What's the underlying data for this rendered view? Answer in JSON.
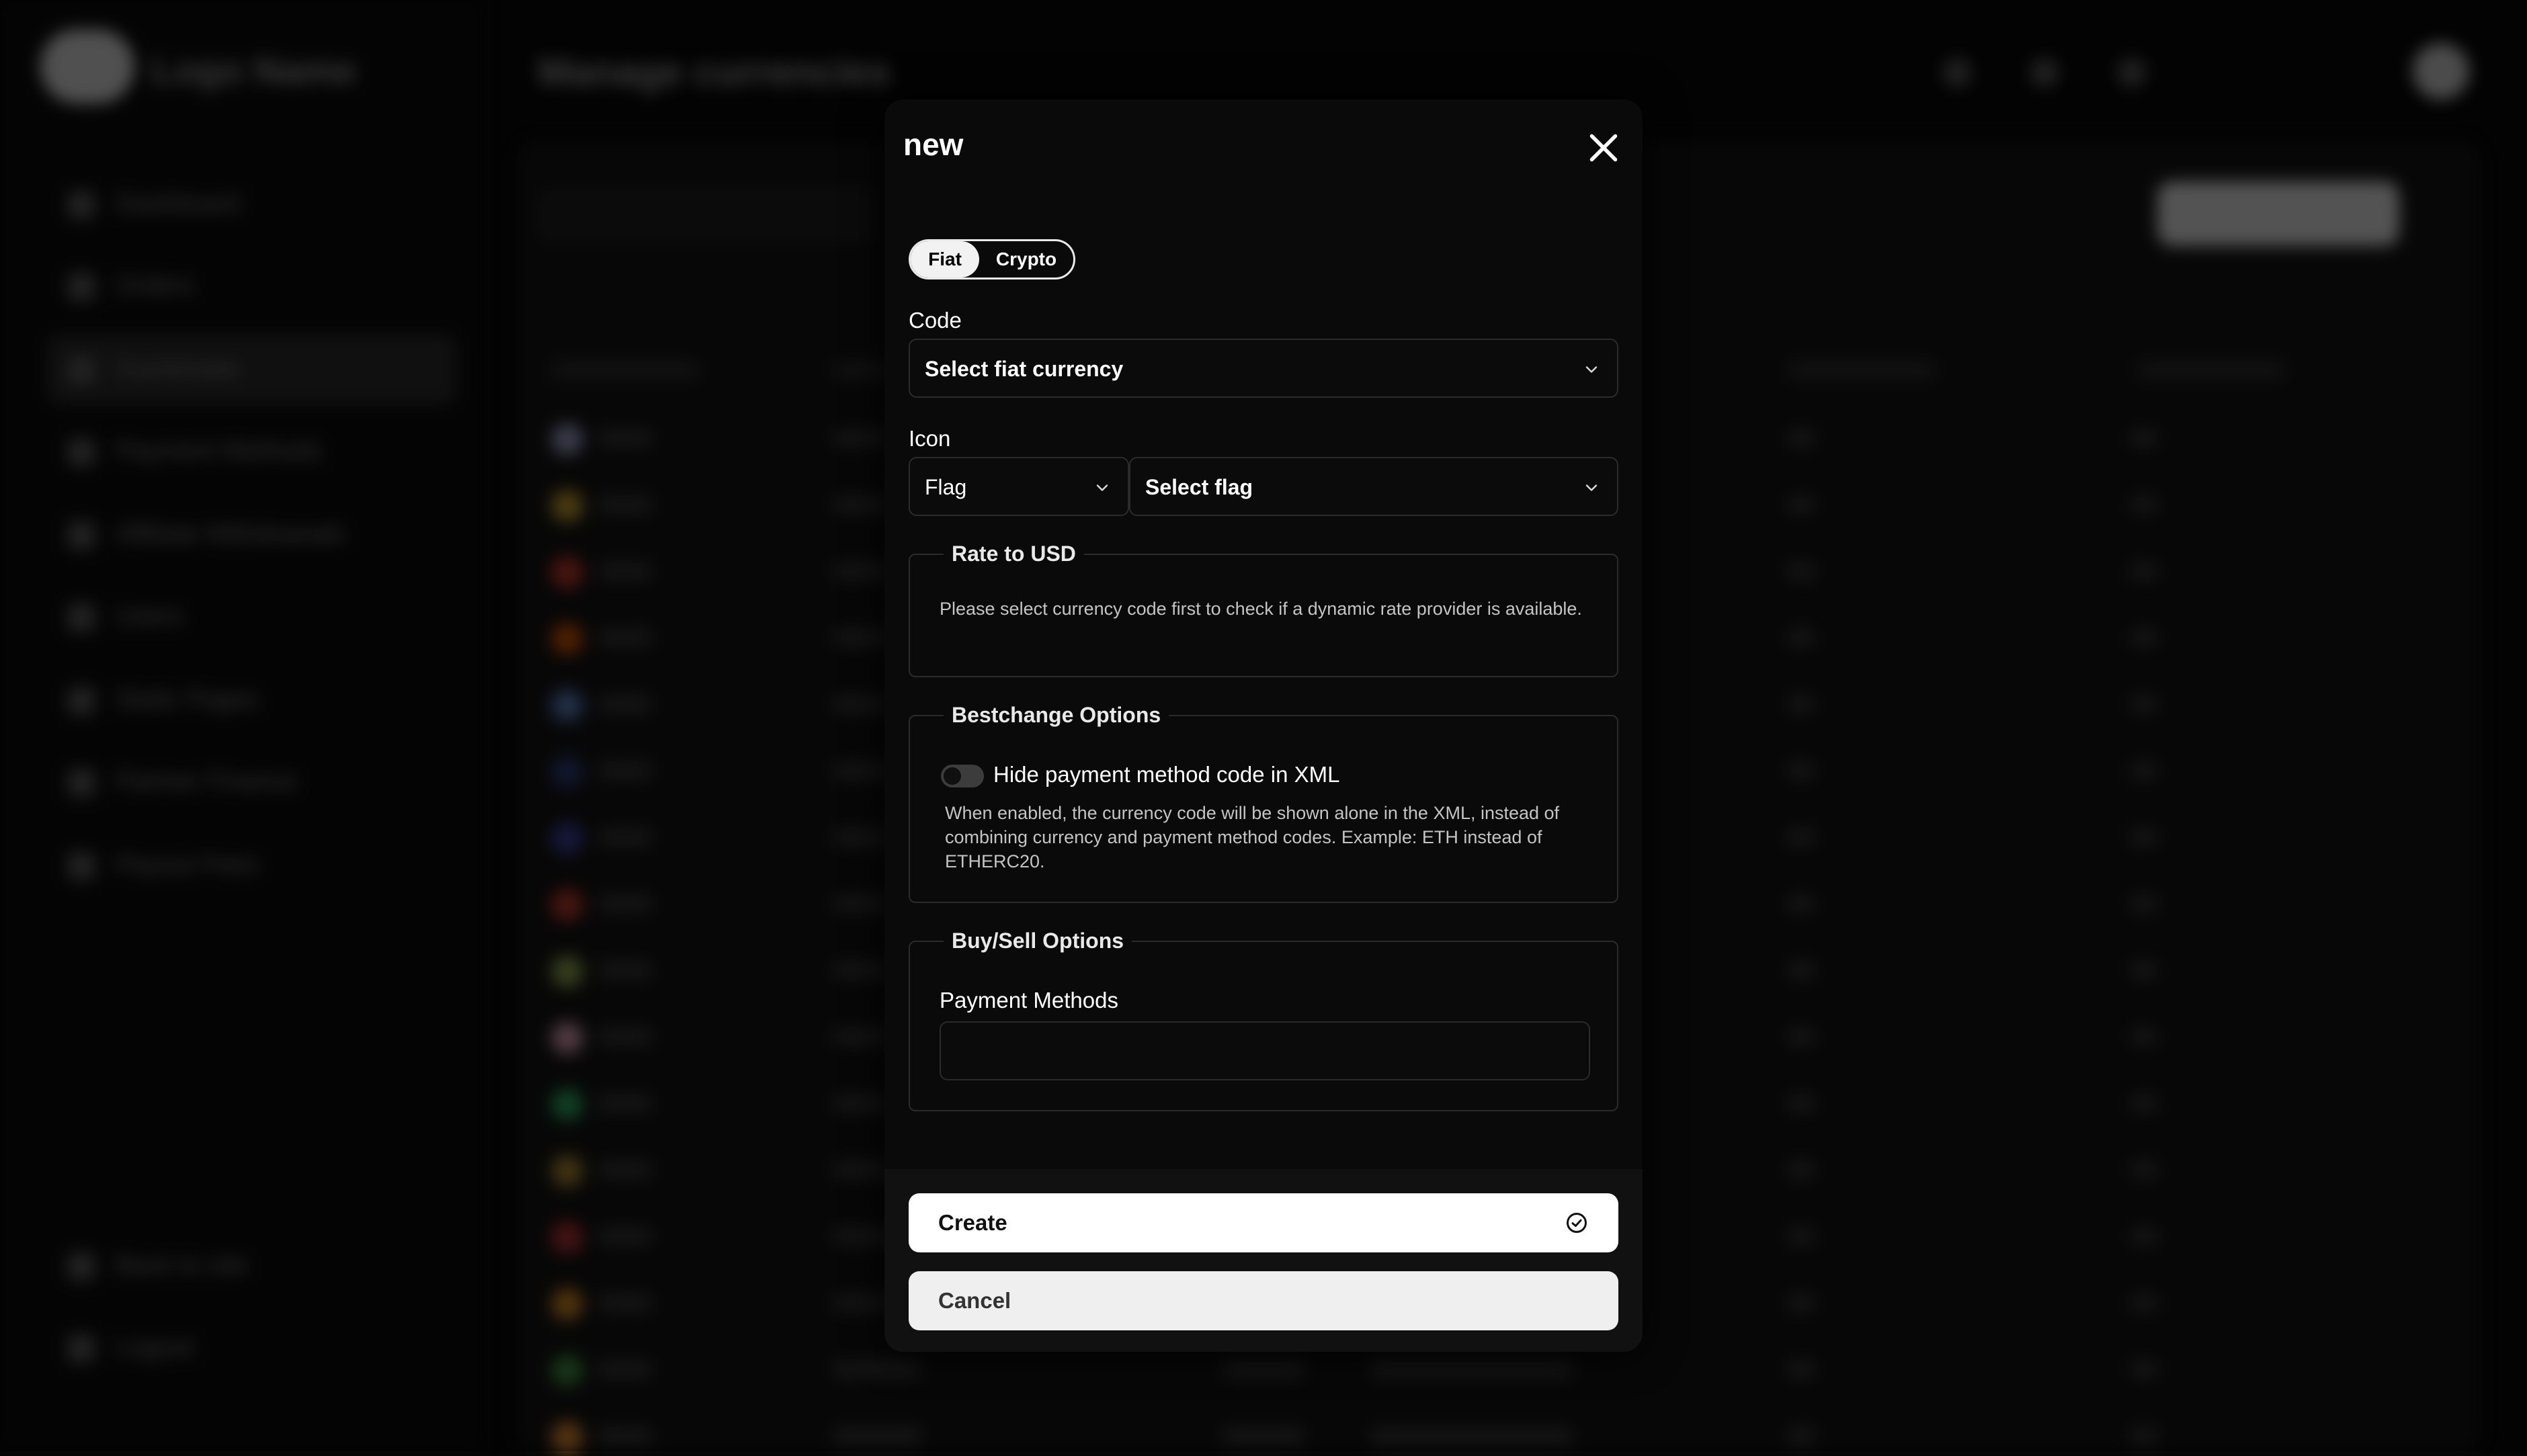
{
  "background": {
    "logo_text": "Logo Name",
    "header_title": "Manage currencies",
    "nav_items": [
      "Dashboard",
      "Orders",
      "Currencies",
      "Payment Methods",
      "Affiliate Withdrawals",
      "Users",
      "Static Pages",
      "Partner Finance",
      "Payout Fees",
      "Back to site",
      "Logout"
    ]
  },
  "modal": {
    "title": "new",
    "close_icon": "close-icon",
    "type_toggle": {
      "fiat_label": "Fiat",
      "crypto_label": "Crypto",
      "selected": "Fiat"
    },
    "code": {
      "label": "Code",
      "value": "Select fiat currency"
    },
    "icon_field": {
      "label": "Icon",
      "type_value": "Flag",
      "flag_value": "Select flag"
    },
    "rate_section": {
      "legend": "Rate to USD",
      "help_text": "Please select currency code first to check if a dynamic rate provider is available."
    },
    "bestchange_section": {
      "legend": "Bestchange Options",
      "toggle_label": "Hide payment method code in XML",
      "toggle_on": false,
      "help_text": "When enabled, the currency code will be shown alone in the XML, instead of combining currency and payment method codes. Example: ETH instead of ETHERC20."
    },
    "buysell_section": {
      "legend": "Buy/Sell Options",
      "payment_methods_label": "Payment Methods",
      "payment_methods_value": ""
    },
    "buttons": {
      "create_label": "Create",
      "create_icon": "check-circle-icon",
      "cancel_label": "Cancel"
    }
  },
  "colors": {
    "modal_bg": "#0a0a0a",
    "border": "#2b2b2b",
    "primary_button": "#ffffff"
  }
}
